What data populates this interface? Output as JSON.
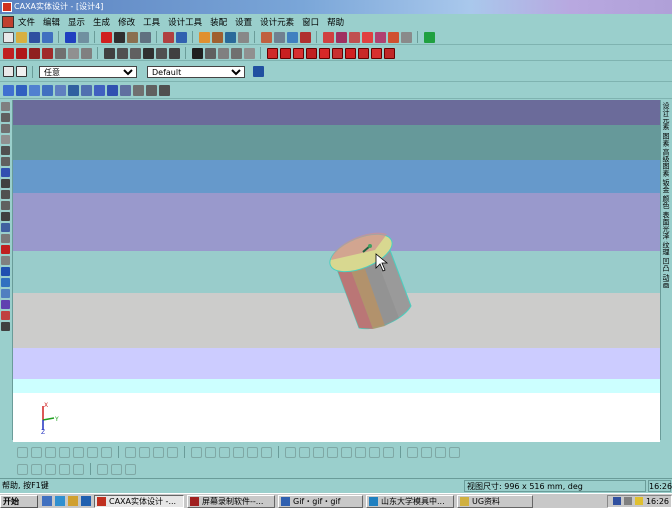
{
  "window": {
    "title": "CAXA实体设计 - [设计4]"
  },
  "menu": [
    "文件",
    "编辑",
    "显示",
    "生成",
    "修改",
    "工具",
    "设计工具",
    "装配",
    "设置",
    "设计元素",
    "窗口",
    "帮助"
  ],
  "selectors": {
    "filter_value": "任意",
    "style_value": "Default"
  },
  "right_panel": {
    "labels": "设计元素 图素 高级图素 钣金 颜色 表面光泽 纹理 凹凸 动画"
  },
  "axes": {
    "x": "X",
    "y": "Y",
    "z": "Z"
  },
  "status": {
    "hint": "帮助, 按F1键",
    "view_size": "视图尺寸:  996 x 516  mm, deg",
    "time": "16:26"
  },
  "taskbar": {
    "start_label": "开始",
    "tasks": [
      "CAXA实体设计 -...",
      "屏幕录制软件--...",
      "Gif・gif・gif",
      "山东大学模具中...",
      "UG资料"
    ],
    "tray_time": "16:26"
  },
  "colors": {
    "titlebar_start": "#5b82c0",
    "ui_bg": "#9acfcc",
    "cylinder_top": "#d8d890"
  }
}
